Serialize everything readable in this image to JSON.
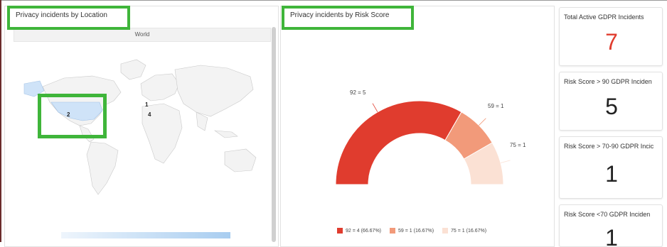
{
  "location_panel": {
    "title": "Privacy incidents by Location",
    "map_header": "World",
    "markers": [
      {
        "id": "usa",
        "value": "2"
      },
      {
        "id": "europe-north",
        "value": "1"
      },
      {
        "id": "europe-central",
        "value": "4"
      }
    ],
    "legend_colors": [
      "#eef5fc",
      "#a8cdf0"
    ]
  },
  "risk_panel": {
    "title": "Privacy incidents by Risk Score",
    "chart_data": {
      "type": "pie",
      "categories": [
        "92",
        "59",
        "75"
      ],
      "values": [
        4,
        1,
        1
      ],
      "slice_labels": [
        "92 = 5",
        "59 = 1",
        "75 = 1"
      ],
      "legend_entries": [
        "92 = 4 (66.67%)",
        "59 = 1 (16.67%)",
        "75 = 1 (16.67%)"
      ],
      "colors": [
        "#e03c2e",
        "#f29a7a",
        "#fbe1d4"
      ],
      "style": "semi-donut"
    }
  },
  "kpis": [
    {
      "title": "Total Active GDPR Incidents",
      "value": "7",
      "color": "#e03c2e"
    },
    {
      "title": "Risk Score > 90 GDPR Inciden",
      "value": "5",
      "color": "#222222"
    },
    {
      "title": "Risk Score > 70-90 GDPR Incic",
      "value": "1",
      "color": "#222222"
    },
    {
      "title": "Risk Score <70 GDPR Inciden",
      "value": "1",
      "color": "#222222"
    }
  ],
  "accent": {
    "highlight": "#3fb53a",
    "map_fill": "#f3f3f3",
    "map_highlight": "#cfe3f8"
  }
}
